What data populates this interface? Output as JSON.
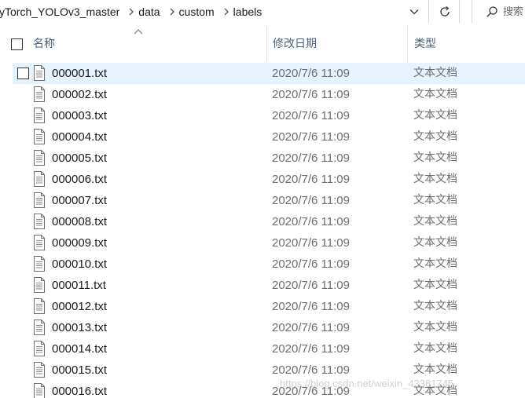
{
  "address_bar": {
    "breadcrumbs": [
      "yTorch_YOLOv3_master",
      "data",
      "custom",
      "labels"
    ]
  },
  "search": {
    "placeholder": "搜索"
  },
  "columns": {
    "name": "名称",
    "date": "修改日期",
    "type": "类型"
  },
  "files": [
    {
      "name": "000001.txt",
      "date": "2020/7/6 11:09",
      "type": "文本文档",
      "selected": true
    },
    {
      "name": "000002.txt",
      "date": "2020/7/6 11:09",
      "type": "文本文档"
    },
    {
      "name": "000003.txt",
      "date": "2020/7/6 11:09",
      "type": "文本文档"
    },
    {
      "name": "000004.txt",
      "date": "2020/7/6 11:09",
      "type": "文本文档"
    },
    {
      "name": "000005.txt",
      "date": "2020/7/6 11:09",
      "type": "文本文档"
    },
    {
      "name": "000006.txt",
      "date": "2020/7/6 11:09",
      "type": "文本文档"
    },
    {
      "name": "000007.txt",
      "date": "2020/7/6 11:09",
      "type": "文本文档"
    },
    {
      "name": "000008.txt",
      "date": "2020/7/6 11:09",
      "type": "文本文档"
    },
    {
      "name": "000009.txt",
      "date": "2020/7/6 11:09",
      "type": "文本文档"
    },
    {
      "name": "000010.txt",
      "date": "2020/7/6 11:09",
      "type": "文本文档"
    },
    {
      "name": "000011.txt",
      "date": "2020/7/6 11:09",
      "type": "文本文档"
    },
    {
      "name": "000012.txt",
      "date": "2020/7/6 11:09",
      "type": "文本文档"
    },
    {
      "name": "000013.txt",
      "date": "2020/7/6 11:09",
      "type": "文本文档"
    },
    {
      "name": "000014.txt",
      "date": "2020/7/6 11:09",
      "type": "文本文档"
    },
    {
      "name": "000015.txt",
      "date": "2020/7/6 11:09",
      "type": "文本文档"
    },
    {
      "name": "000016.txt",
      "date": "2020/7/6 11:09",
      "type": "文本文档"
    }
  ],
  "watermark": "https://blog.csdn.net/weixin_43381745",
  "colors": {
    "selection": "#e5f3ff",
    "header_text": "#4c607a",
    "secondary_text": "#6d6d6d"
  }
}
